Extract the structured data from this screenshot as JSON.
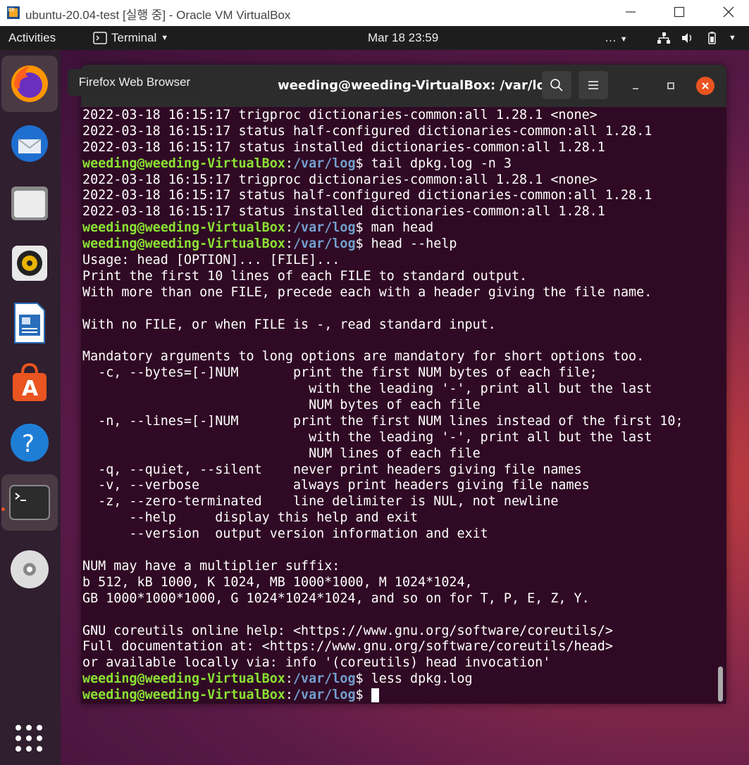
{
  "host_window": {
    "title": "ubuntu-20.04-test [실행 중] - Oracle VM VirtualBox",
    "controls": [
      "minimize-icon",
      "maximize-icon",
      "close-icon"
    ]
  },
  "topbar": {
    "activities": "Activities",
    "app_menu": "Terminal",
    "clock": "Mar 18  23:59",
    "overflow": "…",
    "icons": [
      "network-icon",
      "volume-icon",
      "battery-icon",
      "chevron-down-icon"
    ]
  },
  "dock": {
    "items": [
      "firefox-icon",
      "thunderbird-icon",
      "files-icon",
      "rhythmbox-icon",
      "libreoffice-writer-icon",
      "software-icon",
      "help-icon",
      "terminal-icon",
      "dvd-icon"
    ],
    "tooltip": "Firefox Web Browser",
    "show_apps": "grid-icon"
  },
  "terminal": {
    "title": "weeding@weeding-VirtualBox: /var/log",
    "prompt_user": "weeding@weeding-VirtualBox",
    "prompt_path": "/var/log",
    "lines": [
      {
        "text": "2022-03-18 16:15:17 trigproc dictionaries-common:all 1.28.1 <none>"
      },
      {
        "text": "2022-03-18 16:15:17 status half-configured dictionaries-common:all 1.28.1"
      },
      {
        "text": "2022-03-18 16:15:17 status installed dictionaries-common:all 1.28.1"
      },
      {
        "prompt": true,
        "cmd": " tail dpkg.log -n 3"
      },
      {
        "text": "2022-03-18 16:15:17 trigproc dictionaries-common:all 1.28.1 <none>"
      },
      {
        "text": "2022-03-18 16:15:17 status half-configured dictionaries-common:all 1.28.1"
      },
      {
        "text": "2022-03-18 16:15:17 status installed dictionaries-common:all 1.28.1"
      },
      {
        "prompt": true,
        "cmd": " man head"
      },
      {
        "prompt": true,
        "cmd": " head --help"
      },
      {
        "text": "Usage: head [OPTION]... [FILE]..."
      },
      {
        "text": "Print the first 10 lines of each FILE to standard output."
      },
      {
        "text": "With more than one FILE, precede each with a header giving the file name."
      },
      {
        "text": ""
      },
      {
        "text": "With no FILE, or when FILE is -, read standard input."
      },
      {
        "text": ""
      },
      {
        "text": "Mandatory arguments to long options are mandatory for short options too."
      },
      {
        "text": "  -c, --bytes=[-]NUM       print the first NUM bytes of each file;"
      },
      {
        "text": "                             with the leading '-', print all but the last"
      },
      {
        "text": "                             NUM bytes of each file"
      },
      {
        "text": "  -n, --lines=[-]NUM       print the first NUM lines instead of the first 10;"
      },
      {
        "text": "                             with the leading '-', print all but the last"
      },
      {
        "text": "                             NUM lines of each file"
      },
      {
        "text": "  -q, --quiet, --silent    never print headers giving file names"
      },
      {
        "text": "  -v, --verbose            always print headers giving file names"
      },
      {
        "text": "  -z, --zero-terminated    line delimiter is NUL, not newline"
      },
      {
        "text": "      --help     display this help and exit"
      },
      {
        "text": "      --version  output version information and exit"
      },
      {
        "text": ""
      },
      {
        "text": "NUM may have a multiplier suffix:"
      },
      {
        "text": "b 512, kB 1000, K 1024, MB 1000*1000, M 1024*1024,"
      },
      {
        "text": "GB 1000*1000*1000, G 1024*1024*1024, and so on for T, P, E, Z, Y."
      },
      {
        "text": ""
      },
      {
        "text": "GNU coreutils online help: <https://www.gnu.org/software/coreutils/>"
      },
      {
        "text": "Full documentation at: <https://www.gnu.org/software/coreutils/head>"
      },
      {
        "text": "or available locally via: info '(coreutils) head invocation'"
      },
      {
        "prompt": true,
        "cmd": " less dpkg.log"
      },
      {
        "prompt": true,
        "cmd": " ",
        "cursor": true
      }
    ]
  }
}
